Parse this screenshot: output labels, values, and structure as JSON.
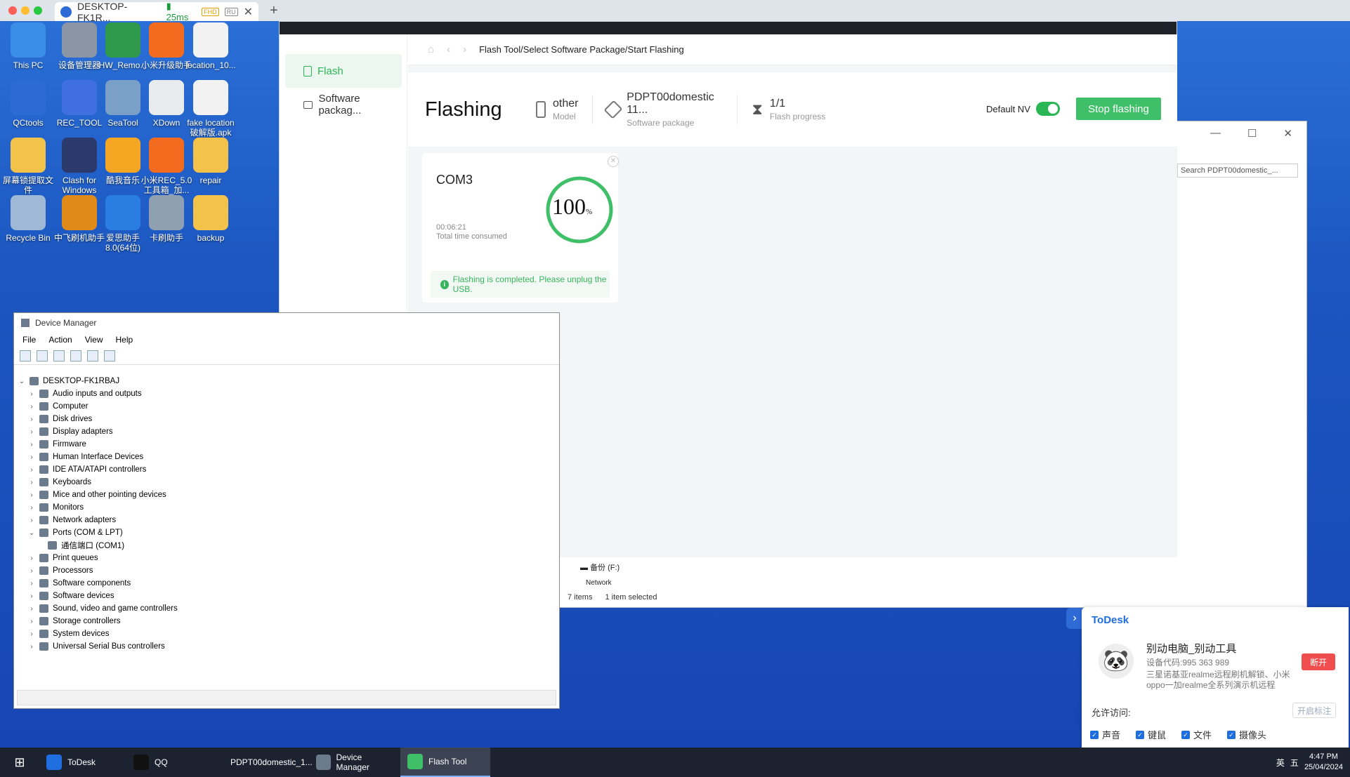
{
  "host": {
    "tab_title": "DESKTOP-FK1R...",
    "ping": "25ms",
    "badge_fhd": "FHD",
    "badge_ru": "RU"
  },
  "desktop_icons": [
    {
      "label": "This PC",
      "color": "#3a8ee6"
    },
    {
      "label": "设备管理器",
      "color": "#8a96a6"
    },
    {
      "label": "HW_Remo...",
      "color": "#2f9a4c"
    },
    {
      "label": "小米升级助手",
      "color": "#f26b1f"
    },
    {
      "label": "location_10...",
      "color": "#f2f2f2"
    },
    {
      "label": "QCtools",
      "color": "#2e6ad6"
    },
    {
      "label": "REC_TOOL",
      "color": "#3f6fe0"
    },
    {
      "label": "SeaTool",
      "color": "#7aa0c8"
    },
    {
      "label": "XDown",
      "color": "#e9ecef"
    },
    {
      "label": "fake location 破解版.apk",
      "color": "#f2f2f2"
    },
    {
      "label": "屏幕锁提取文件",
      "color": "#f2c24b"
    },
    {
      "label": "Clash for Windows",
      "color": "#2a3a6a"
    },
    {
      "label": "酷我音乐",
      "color": "#f5a623"
    },
    {
      "label": "小米REC_5.0工具箱_加...",
      "color": "#f26b1f"
    },
    {
      "label": "repair",
      "color": "#f2c24b"
    },
    {
      "label": "Recycle Bin",
      "color": "#9fb8d6"
    },
    {
      "label": "中飞刷机助手",
      "color": "#e08a1a"
    },
    {
      "label": "爱思助手 8.0(64位)",
      "color": "#2a7de1"
    },
    {
      "label": "卡刷助手",
      "color": "#8fa0b3"
    },
    {
      "label": "backup",
      "color": "#f2c24b"
    }
  ],
  "flash": {
    "sidebar": {
      "flash": "Flash",
      "software": "Software packag..."
    },
    "breadcrumb": "Flash Tool/Select Software Package/Start Flashing",
    "title": "Flashing",
    "model_value": "other",
    "model_label": "Model",
    "package_value": "PDPT00domestic 11...",
    "package_label": "Software package",
    "progress_value": "1/1",
    "progress_label": "Flash progress",
    "default_nv": "Default NV",
    "stop_button": "Stop flashing",
    "card": {
      "port": "COM3",
      "time": "00:06:21",
      "time_label": "Total time consumed",
      "percent": "100",
      "percent_unit": "%",
      "progress_fraction": 1.0,
      "message": "Flashing is completed. Please unplug the USB."
    }
  },
  "devmgr": {
    "title": "Device Manager",
    "menu": [
      "File",
      "Action",
      "View",
      "Help"
    ],
    "root": "DESKTOP-FK1RBAJ",
    "items": [
      "Audio inputs and outputs",
      "Computer",
      "Disk drives",
      "Display adapters",
      "Firmware",
      "Human Interface Devices",
      "IDE ATA/ATAPI controllers",
      "Keyboards",
      "Mice and other pointing devices",
      "Monitors",
      "Network adapters",
      "Ports (COM & LPT)",
      "通信端口 (COM1)",
      "Print queues",
      "Processors",
      "Software components",
      "Software devices",
      "Sound, video and game controllers",
      "Storage controllers",
      "System devices",
      "Universal Serial Bus controllers"
    ]
  },
  "explorer": {
    "search_placeholder": "Search PDPT00domestic_...",
    "drive": "备份 (F:)",
    "network": "Network",
    "items_count": "7 items",
    "selected": "1 item selected"
  },
  "todesk": {
    "logo": "ToDesk",
    "name": "别动电脑_别动工具",
    "code": "设备代码:995 363 989",
    "desc1": "三星诺基亚realme远程刷机解锁、小米",
    "desc2": "oppo一加realme全系列演示机远程",
    "disconnect": "断开",
    "allow": "允许访问:",
    "mark": "开启标注",
    "perms": [
      "声音",
      "键鼠",
      "文件",
      "摄像头"
    ]
  },
  "taskbar": {
    "tasks": [
      "ToDesk",
      "QQ",
      "PDPT00domestic_1...",
      "Device Manager",
      "Flash Tool"
    ],
    "ime": "英",
    "ime2": "五",
    "time": "4:47 PM",
    "date": "25/04/2024"
  },
  "colors": {
    "accent_green": "#2bb656",
    "todesk_blue": "#1f6ee0",
    "disconnect_red": "#f04e4e"
  }
}
